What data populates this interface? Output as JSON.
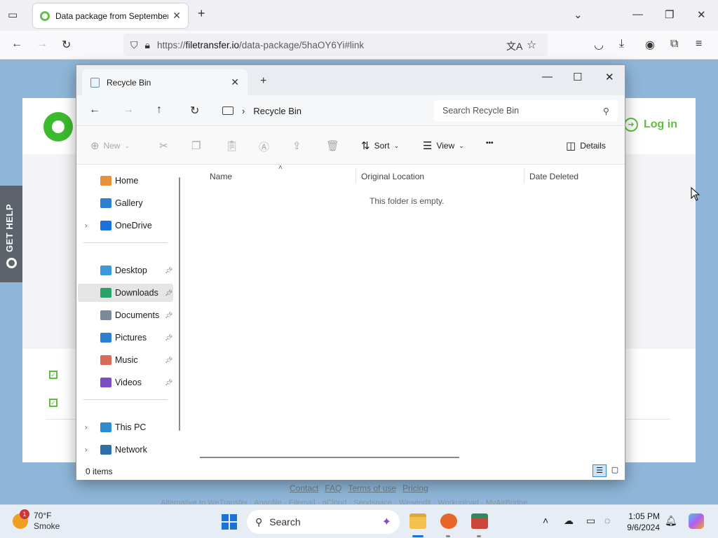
{
  "browser": {
    "tab_title": "Data package from September",
    "tab_close": "✕",
    "new_tab": "+",
    "url_prefix": "https://",
    "url_domain": "filetransfer.io",
    "url_path": "/data-package/5haOY6Yi#link",
    "controls": {
      "list_all_tabs": "⌄",
      "minimize": "—",
      "restore": "❐",
      "close": "✕"
    },
    "nav": {
      "back": "←",
      "forward": "→",
      "reload": "↻"
    },
    "toolbar_icons": [
      "translate-icon",
      "bookmark-star-icon",
      "pocket-icon",
      "downloads-icon",
      "account-icon",
      "extensions-icon",
      "menu-icon"
    ]
  },
  "webpage": {
    "login_label": "Log in",
    "get_help_label": "GET HELP",
    "footer_links": [
      "Contact",
      "FAQ",
      "Terms of use",
      "Pricing"
    ],
    "footer_sub": "Alternative to WeTransfer · Anonfile · Filemail · oCloud · Sendspace · Wesendit · Workupload · MyAirBridge"
  },
  "explorer": {
    "tab_title": "Recycle Bin",
    "new_tab": "+",
    "window_controls": {
      "minimize": "—",
      "maximize": "☐",
      "close": "✕"
    },
    "nav": {
      "back": "←",
      "forward": "→",
      "up": "↑",
      "refresh": "↻"
    },
    "breadcrumb": [
      "Recycle Bin"
    ],
    "search_placeholder": "Search Recycle Bin",
    "commands": {
      "new": "New",
      "sort": "Sort",
      "view": "View",
      "more": "•••",
      "details": "Details"
    },
    "nav_pane": [
      {
        "label": "Home",
        "icon": "home-icon",
        "color": "#e8913c",
        "pinned": false,
        "expandable": false
      },
      {
        "label": "Gallery",
        "icon": "gallery-icon",
        "color": "#2f7fd0",
        "pinned": false,
        "expandable": false
      },
      {
        "label": "OneDrive",
        "icon": "onedrive-cloud-icon",
        "color": "#1a73d9",
        "pinned": false,
        "expandable": true
      },
      {
        "label": "Desktop",
        "icon": "desktop-icon",
        "color": "#3a9ad9",
        "pinned": true,
        "expandable": false
      },
      {
        "label": "Downloads",
        "icon": "downloads-icon",
        "color": "#2aa36b",
        "pinned": true,
        "expandable": false,
        "selected": true
      },
      {
        "label": "Documents",
        "icon": "documents-icon",
        "color": "#7b8a99",
        "pinned": true,
        "expandable": false
      },
      {
        "label": "Pictures",
        "icon": "pictures-icon",
        "color": "#2f7fd0",
        "pinned": true,
        "expandable": false
      },
      {
        "label": "Music",
        "icon": "music-icon",
        "color": "#d86a5a",
        "pinned": true,
        "expandable": false
      },
      {
        "label": "Videos",
        "icon": "videos-icon",
        "color": "#7b4fc2",
        "pinned": true,
        "expandable": false
      },
      {
        "label": "This PC",
        "icon": "this-pc-icon",
        "color": "#2f8ad0",
        "pinned": false,
        "expandable": true
      },
      {
        "label": "Network",
        "icon": "network-icon",
        "color": "#2f6fa8",
        "pinned": false,
        "expandable": true
      }
    ],
    "columns": [
      "Name",
      "Original Location",
      "Date Deleted"
    ],
    "empty_message": "This folder is empty.",
    "status": "0 items"
  },
  "taskbar": {
    "weather_temp": "70°F",
    "weather_desc": "Smoke",
    "weather_badge": "1",
    "search_label": "Search",
    "time": "1:05 PM",
    "date": "9/6/2024"
  }
}
